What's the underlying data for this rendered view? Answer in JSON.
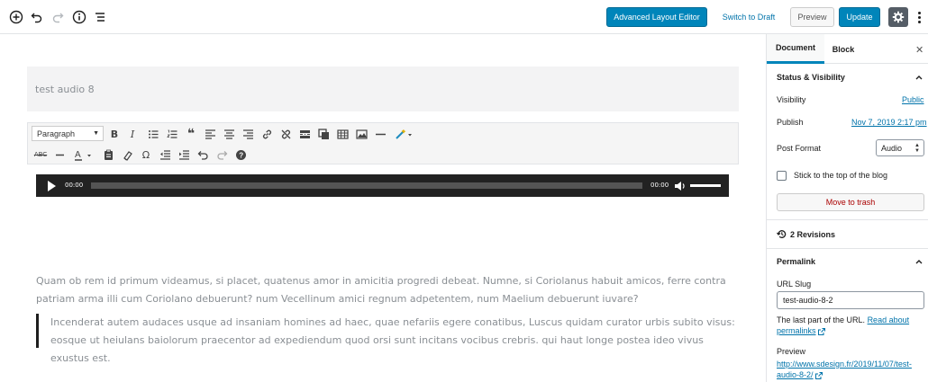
{
  "toolbar": {
    "advanced_layout_editor": "Advanced Layout Editor",
    "switch_to_draft": "Switch to Draft",
    "preview": "Preview",
    "update": "Update"
  },
  "editor": {
    "title": "test  audio 8",
    "format_select": "Paragraph",
    "audio": {
      "current_time": "00:00",
      "duration": "00:00"
    },
    "paragraph": "Quam ob rem id primum videamus, si placet, quatenus amor in amicitia progredi debeat. Numne, si Coriolanus habuit amicos, ferre contra patriam arma illi cum Coriolano debuerunt? num Vecellinum amici regnum adpetentem, num Maelium debuerunt iuvare?",
    "quote": "Incenderat autem audaces usque ad insaniam homines ad haec, quae nefariis egere conatibus, Luscus quidam curator urbis subito visus: eosque ut heiulans baiolorum praecentor ad expediendum quod orsi sunt incitans vocibus crebris. qui haut longe postea ideo vivus exustus est."
  },
  "sidebar": {
    "tabs": {
      "document": "Document",
      "block": "Block"
    },
    "status_visibility": {
      "title": "Status & Visibility",
      "visibility_label": "Visibility",
      "visibility_value": "Public",
      "publish_label": "Publish",
      "publish_value": "Nov 7, 2019 2:17 pm",
      "post_format_label": "Post Format",
      "post_format_value": "Audio",
      "stick_label": "Stick to the top of the blog",
      "trash": "Move to trash"
    },
    "revisions": "2 Revisions",
    "permalink": {
      "title": "Permalink",
      "url_slug_label": "URL Slug",
      "url_slug_value": "test-audio-8-2",
      "help_text": "The last part of the URL.",
      "help_link": "Read about permalinks",
      "preview_label": "Preview",
      "preview_url": "http://www.sdesign.fr/2019/11/07/test-audio-8-2/"
    }
  }
}
